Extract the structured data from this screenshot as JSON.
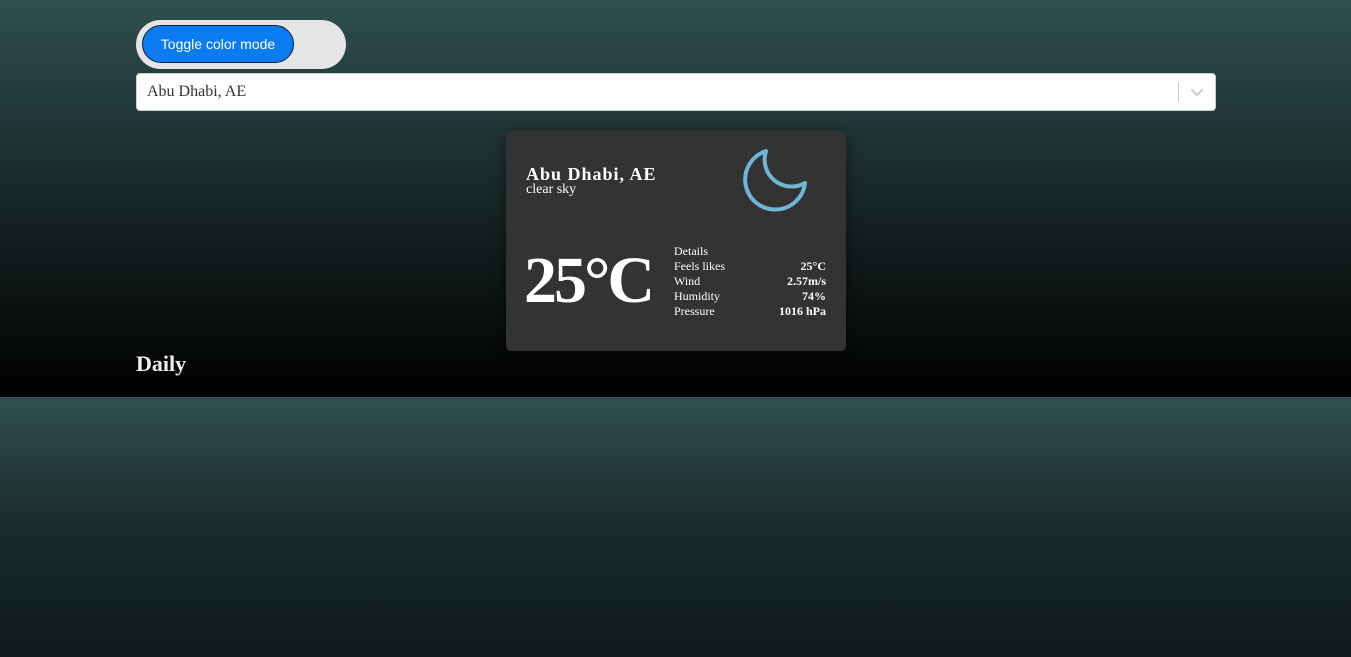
{
  "toggle": {
    "label": "Toggle color mode"
  },
  "search": {
    "selected_value": "Abu Dhabi, AE"
  },
  "current": {
    "city": "Abu Dhabi, AE",
    "description": "clear sky",
    "icon": "moon-icon",
    "temperature": "25°C",
    "details_title": "Details",
    "details": [
      {
        "label": "Feels likes",
        "value": "25°C"
      },
      {
        "label": "Wind",
        "value": "2.57m/s"
      },
      {
        "label": "Humidity",
        "value": "74%"
      },
      {
        "label": "Pressure",
        "value": "1016 hPa"
      }
    ]
  },
  "daily": {
    "heading": "Daily"
  },
  "colors": {
    "accent": "#0d7cf2",
    "icon": "#6fb6d6",
    "card_bg": "#333333"
  }
}
